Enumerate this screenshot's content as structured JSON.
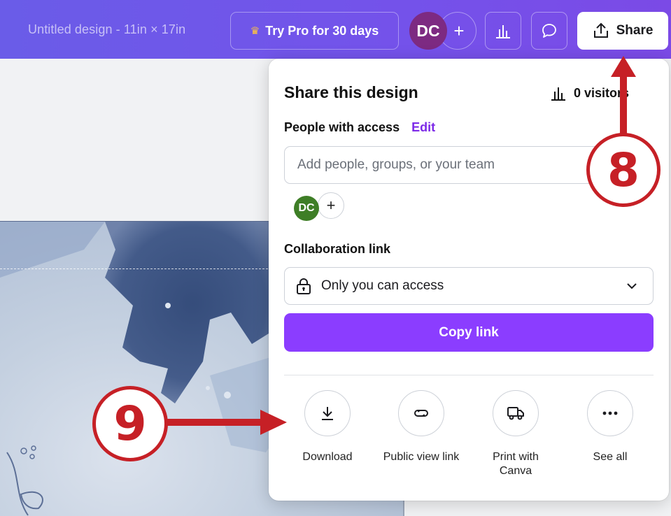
{
  "topbar": {
    "doc_title": "Untitled design - 11in × 17in",
    "pro_button": "Try Pro for 30 days",
    "avatar_initials": "DC",
    "add_symbol": "+",
    "share_label": "Share",
    "icons": [
      "crown-icon",
      "insights-icon",
      "comment-icon",
      "upload-icon"
    ]
  },
  "share_panel": {
    "title": "Share this design",
    "visitors": "0 visitors",
    "people_label": "People with access",
    "edit_label": "Edit",
    "people_placeholder": "Add people, groups, or your team",
    "member_initials": "DC",
    "add_member_symbol": "+",
    "collab_label": "Collaboration link",
    "access_value": "Only you can access",
    "copy_label": "Copy link",
    "options": [
      {
        "label": "Download",
        "icon": "download-icon"
      },
      {
        "label": "Public view link",
        "icon": "link-icon"
      },
      {
        "label": "Print with Canva",
        "icon": "truck-icon"
      },
      {
        "label": "See all",
        "icon": "more-icon"
      }
    ]
  },
  "annotations": {
    "marker_8": "8",
    "marker_9": "9",
    "color": "#c62026"
  },
  "colors": {
    "brand_purple": "#8b3dff",
    "edit_link": "#7d2ae8",
    "topbar_gradient_start": "#6a5ce8",
    "avatar_purple": "#7d2a82",
    "member_green": "#3e7e26"
  }
}
